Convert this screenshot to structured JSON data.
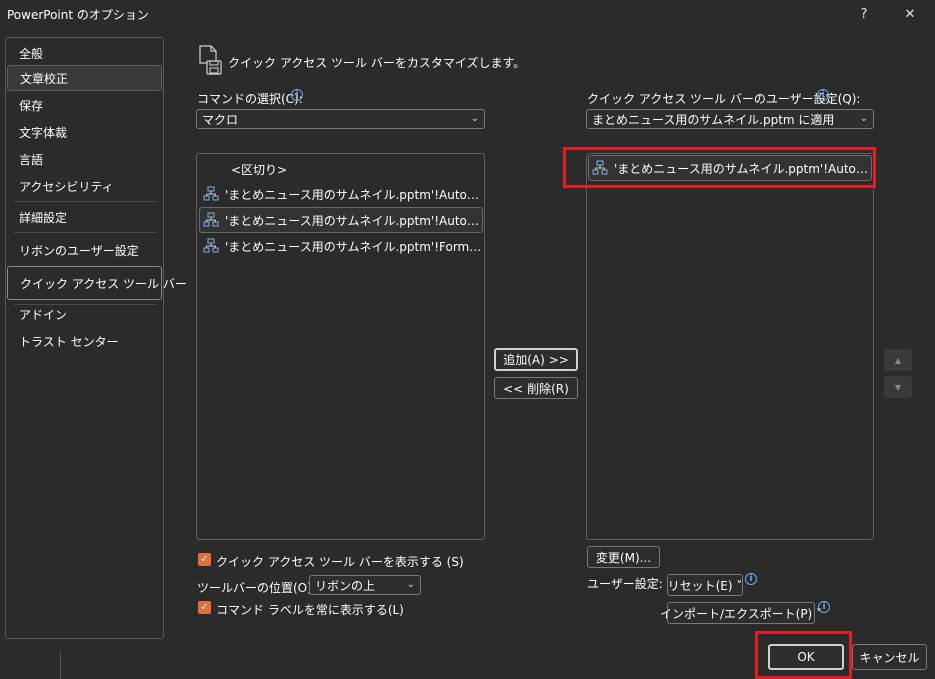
{
  "window": {
    "title": "PowerPoint のオプション",
    "help_label": "?",
    "close_label": "✕"
  },
  "sidebar": {
    "items": [
      {
        "label": "全般"
      },
      {
        "label": "文章校正"
      },
      {
        "label": "保存"
      },
      {
        "label": "文字体裁"
      },
      {
        "label": "言語"
      },
      {
        "label": "アクセシビリティ"
      },
      {
        "label": "詳細設定"
      },
      {
        "label": "リボンのユーザー設定"
      },
      {
        "label": "クイック アクセス ツール バー"
      },
      {
        "label": "アドイン"
      },
      {
        "label": "トラスト センター"
      }
    ]
  },
  "main": {
    "heading": "クイック アクセス ツール バーをカスタマイズします。",
    "commands_label": "コマンドの選択(C):",
    "commands_value": "マクロ",
    "commands_list": [
      {
        "label": "<区切り>"
      },
      {
        "label": "'まとめニュース用のサムネイル.pptm'!Auto…"
      },
      {
        "label": "'まとめニュース用のサムネイル.pptm'!Auto…"
      },
      {
        "label": "'まとめニュース用のサムネイル.pptm'!Form…"
      }
    ],
    "customize_label": "クイック アクセス ツール バーのユーザー設定(Q):",
    "customize_value": "まとめニュース用のサムネイル.pptm に適用",
    "customize_list": [
      {
        "label": "'まとめニュース用のサムネイル.pptm'!Auto…"
      }
    ],
    "add_button": "追加(A) >>",
    "remove_button": "<< 削除(R)",
    "up_arrow": "▲",
    "down_arrow": "▼",
    "show_toolbar_label": "クイック アクセス ツール バーを表示する (S)",
    "show_toolbar_checked": true,
    "toolbar_position_label": "ツールバーの位置(O)",
    "toolbar_position_value": "リボンの上",
    "always_show_labels": "コマンド ラベルを常に表示する(L)",
    "always_show_checked": true,
    "modify_button": "変更(M)...",
    "user_settings_label": "ユーザー設定:",
    "reset_button": "リセット(E) ˅",
    "import_export_button": "インポート/エクスポート(P) ˅",
    "info_glyph": "i",
    "check_glyph": "✓",
    "chevron_glyph": "⌄"
  },
  "footer": {
    "ok_button": "OK",
    "cancel_button": "キャンセル"
  },
  "colors": {
    "background": "#2b2b2b",
    "accent_checkbox": "#e07040",
    "info_icon": "#6ba8e8",
    "highlight_box": "#e01e24"
  }
}
